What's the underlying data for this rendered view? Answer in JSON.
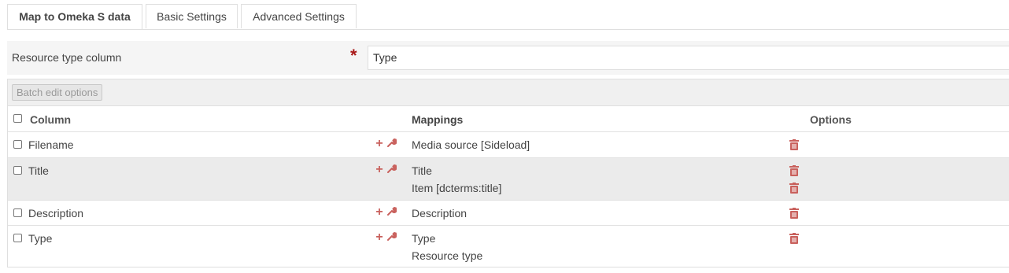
{
  "tabs": [
    {
      "label": "Map to Omeka S data",
      "active": true
    },
    {
      "label": "Basic Settings",
      "active": false
    },
    {
      "label": "Advanced Settings",
      "active": false
    }
  ],
  "resource_type": {
    "label": "Resource type column",
    "required_marker": "*",
    "value": "Type"
  },
  "batch": {
    "label": "Batch edit options"
  },
  "table": {
    "headers": {
      "column": "Column",
      "mappings": "Mappings",
      "options": "Options"
    },
    "rows": [
      {
        "column": "Filename",
        "mappings": [
          "Media source [Sideload]"
        ]
      },
      {
        "column": "Title",
        "mappings": [
          "Title",
          "Item [dcterms:title]"
        ]
      },
      {
        "column": "Description",
        "mappings": [
          "Description"
        ]
      },
      {
        "column": "Type",
        "mappings": [
          "Type",
          "Resource type"
        ]
      }
    ]
  },
  "icons": {
    "add": "plus-icon",
    "configure": "wrench-icon",
    "delete": "trash-icon"
  },
  "colors": {
    "accent": "#c9615d",
    "required": "#a91919"
  }
}
